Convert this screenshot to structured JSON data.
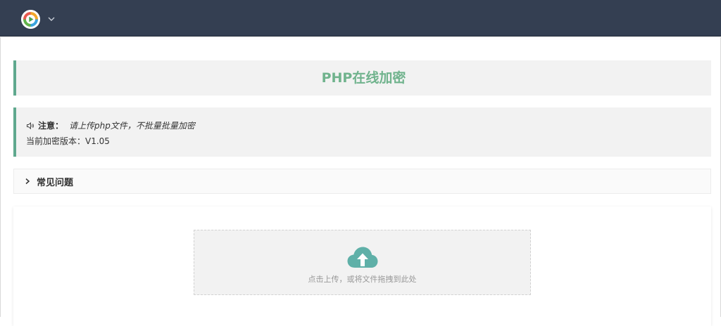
{
  "header": {
    "logo_icon": "play-logo-icon",
    "menu_icon": "chevron-down-icon",
    "background": "#343f52"
  },
  "main": {
    "title": "PHP在线加密",
    "notice": {
      "icon": "speaker-icon",
      "label": "注意：",
      "text": "请上传php文件，不批量批量加密",
      "version_line": "当前加密版本：V1.05"
    },
    "faq": {
      "icon": "chevron-right-icon",
      "label": "常见问题"
    },
    "upload": {
      "icon": "cloud-upload-icon",
      "hint": "点击上传，或将文件拖拽到此处"
    }
  },
  "colors": {
    "accent": "#5fa88e",
    "title_green": "#70b38d",
    "upload_icon": "#5fb0a8"
  }
}
